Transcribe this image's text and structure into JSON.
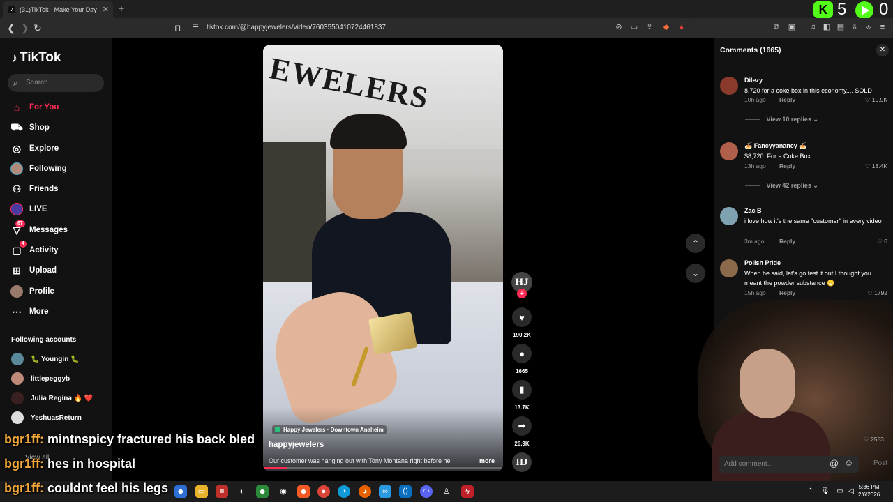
{
  "browser": {
    "tab_title": "(31)TikTok - Make Your Day",
    "url": "tiktok.com/@happyjewelers/video/7603550410724461837",
    "kick_count": "5",
    "play_count": "0"
  },
  "sidebar": {
    "brand": "TikTok",
    "search_placeholder": "Search",
    "nav": [
      {
        "label": "For You"
      },
      {
        "label": "Shop"
      },
      {
        "label": "Explore"
      },
      {
        "label": "Following"
      },
      {
        "label": "Friends"
      },
      {
        "label": "LIVE"
      },
      {
        "label": "Messages",
        "badge": "87"
      },
      {
        "label": "Activity",
        "badge": "4"
      },
      {
        "label": "Upload"
      },
      {
        "label": "Profile"
      },
      {
        "label": "More"
      }
    ],
    "following_title": "Following accounts",
    "accounts": [
      "🐛 Youngin 🐛",
      "littlepeggyb",
      "Julia Regina 🔥 ❤️",
      "YeshuasReturn"
    ],
    "view_all": "View all"
  },
  "chat": [
    {
      "user": "bgr1ff:",
      "text": " mintnspicy fractured his back bled"
    },
    {
      "user": "bgr1ff:",
      "text": " hes in hospital"
    },
    {
      "user": "bgr1ff:",
      "text": " couldnt feel his legs"
    }
  ],
  "video": {
    "sign": "EWELERS",
    "location": "Happy Jewelers · Downtown Anaheim",
    "author": "happyjewelers",
    "caption": "Our customer was hanging out with Tony Montana right before he",
    "more": "more",
    "progress": 0.1,
    "creator_initials": "HJ",
    "likes": "190.2K",
    "comments": "1665",
    "saves": "13.7K",
    "shares": "26.9K"
  },
  "comments": {
    "title": "Comments (1665)",
    "items": [
      {
        "name": "Dilezy",
        "text": "8,720 for a coke box in this economy.... SOLD",
        "time": "10h ago",
        "likes": "10.9K",
        "replies": "View 10 replies",
        "color": "#8a3a2a"
      },
      {
        "name": "🍝 Fancyyanancy 🍝",
        "text": "$8,720. For a Coke Box",
        "time": "13h ago",
        "likes": "18.4K",
        "replies": "View 42 replies",
        "color": "#b0604a"
      },
      {
        "name": "Zac B",
        "text": "i love how it's the same \"customer\" in every video",
        "time": "3m ago",
        "likes": "0",
        "replies": "",
        "color": "#7fa2b0"
      },
      {
        "name": "Polish Pride",
        "text": "When he said, let's go test it out I thought you meant the powder substance 😁",
        "time": "15h ago",
        "likes": "1792",
        "replies": "",
        "color": "#8a6a4a"
      }
    ],
    "reply_label": "Reply",
    "hidden_likes": "2553",
    "add_placeholder": "Add comment...",
    "post": "Post"
  },
  "taskbar": {
    "time": "5:36 PM",
    "date": "2/6/2026"
  },
  "colors": {
    "accent": "#fe2c55",
    "kick": "#53fc18",
    "chat_user": "#f0a83a"
  }
}
